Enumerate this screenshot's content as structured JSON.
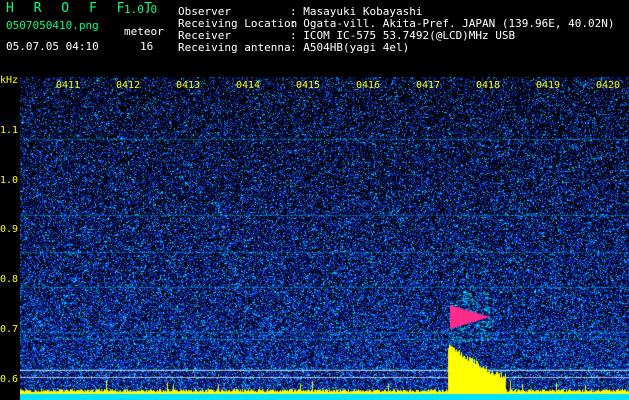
{
  "app": {
    "title": "H R O F F T",
    "version": "1.0.0"
  },
  "file": {
    "name": "0507050410.png",
    "datetime": "05.07.05 04:10"
  },
  "meteor": {
    "label": "meteor",
    "count": "16"
  },
  "info": [
    {
      "label": "Observer",
      "value": ": Masayuki Kobayashi"
    },
    {
      "label": "Receiving Location",
      "value": ": Ogata-vill. Akita-Pref. JAPAN (139.96E, 40.02N)"
    },
    {
      "label": "Receiver",
      "value": ": ICOM IC-575 53.7492(@LCD)MHz USB"
    },
    {
      "label": "Receiving antenna",
      "value": ": A504HB(yagi 4el)"
    }
  ],
  "spectrogram": {
    "y_unit": "kHz",
    "y_ticks": [
      "1.1",
      "1.0",
      "0.9",
      "0.8",
      "0.7",
      "0.6"
    ],
    "x_ticks": [
      "0411",
      "0412",
      "0413",
      "0414",
      "0415",
      "0416",
      "0417",
      "0418",
      "0419",
      "0420"
    ],
    "colors": {
      "background": "#000000",
      "noise_low": "#0a1a8c",
      "noise_mid": "#1a5cff",
      "noise_high": "#00e0ff",
      "echo": "#ff2a8a",
      "power": "#ffff00",
      "baseline": "#00e0ff"
    }
  }
}
